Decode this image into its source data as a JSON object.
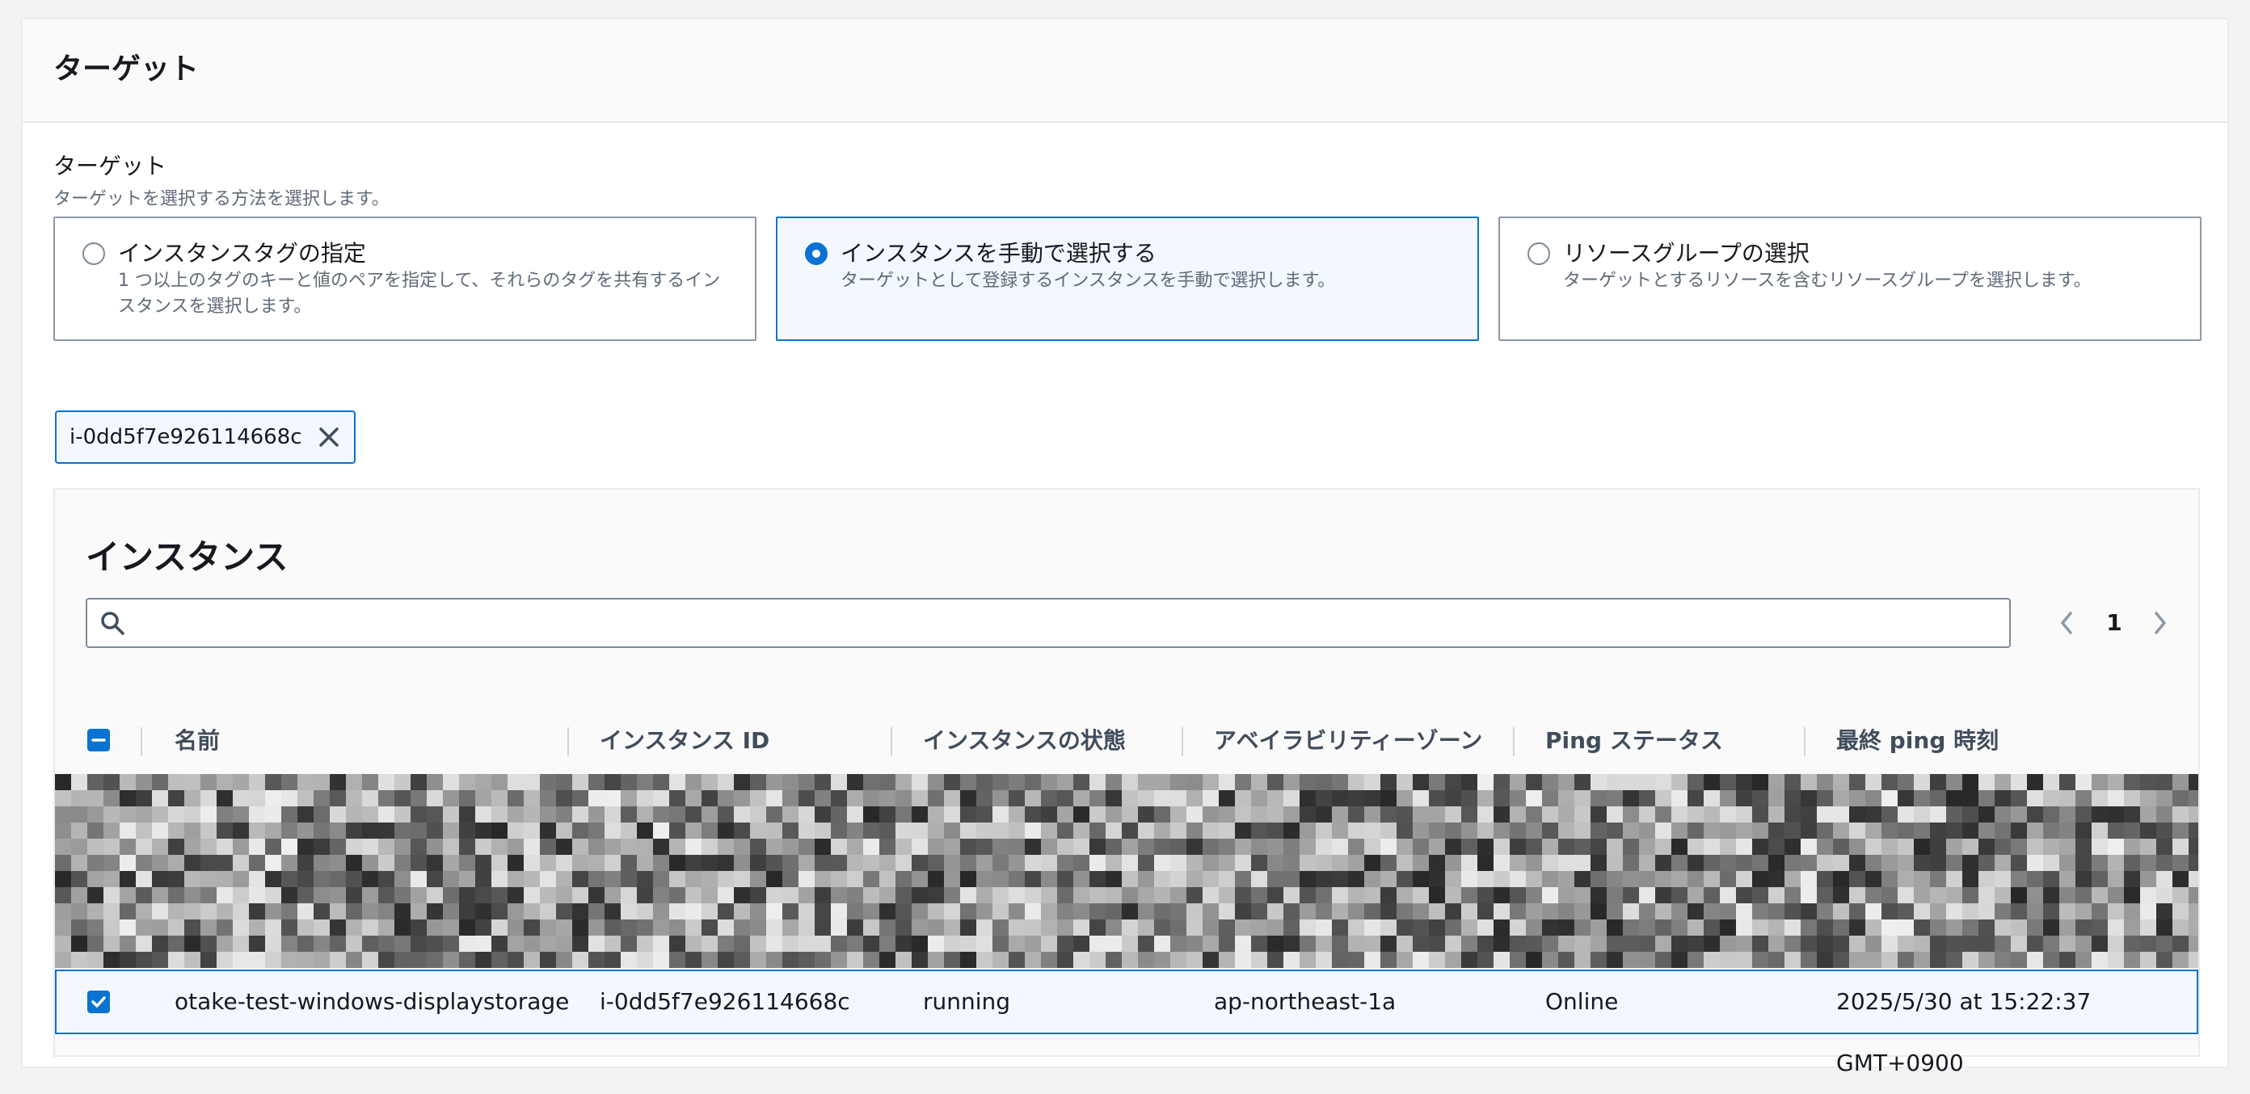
{
  "section": {
    "title": "ターゲット"
  },
  "target_field": {
    "label": "ターゲット",
    "description": "ターゲットを選択する方法を選択します。",
    "options": [
      {
        "title": "インスタンスタグの指定",
        "description": "1 つ以上のタグのキーと値のペアを指定して、それらのタグを共有するインスタンスを選択します。",
        "selected": false
      },
      {
        "title": "インスタンスを手動で選択する",
        "description": "ターゲットとして登録するインスタンスを手動で選択します。",
        "selected": true
      },
      {
        "title": "リソースグループの選択",
        "description": "ターゲットとするリソースを含むリソースグループを選択します。",
        "selected": false
      }
    ]
  },
  "selected_token": {
    "label": "i-0dd5f7e926114668c",
    "remove_icon": "close-icon"
  },
  "instances": {
    "title": "インスタンス",
    "search": {
      "value": "",
      "placeholder": "",
      "icon": "search-icon"
    },
    "pagination": {
      "current_page": "1"
    },
    "columns": [
      "名前",
      "インスタンス ID",
      "インスタンスの状態",
      "アベイラビリティーゾーン",
      "Ping ステータス",
      "最終 ping 時刻"
    ],
    "rows": [
      {
        "selected": true,
        "cells": [
          "otake-test-windows-displaystorage",
          "i-0dd5f7e926114668c",
          "running",
          "ap-northeast-1a",
          "Online",
          "2025/5/30 at 15:22:37 GMT+0900"
        ]
      }
    ]
  },
  "colors": {
    "accent": "#0972d3",
    "text": "#16191f",
    "muted": "#5f6b7a",
    "border": "#8d99a8"
  }
}
